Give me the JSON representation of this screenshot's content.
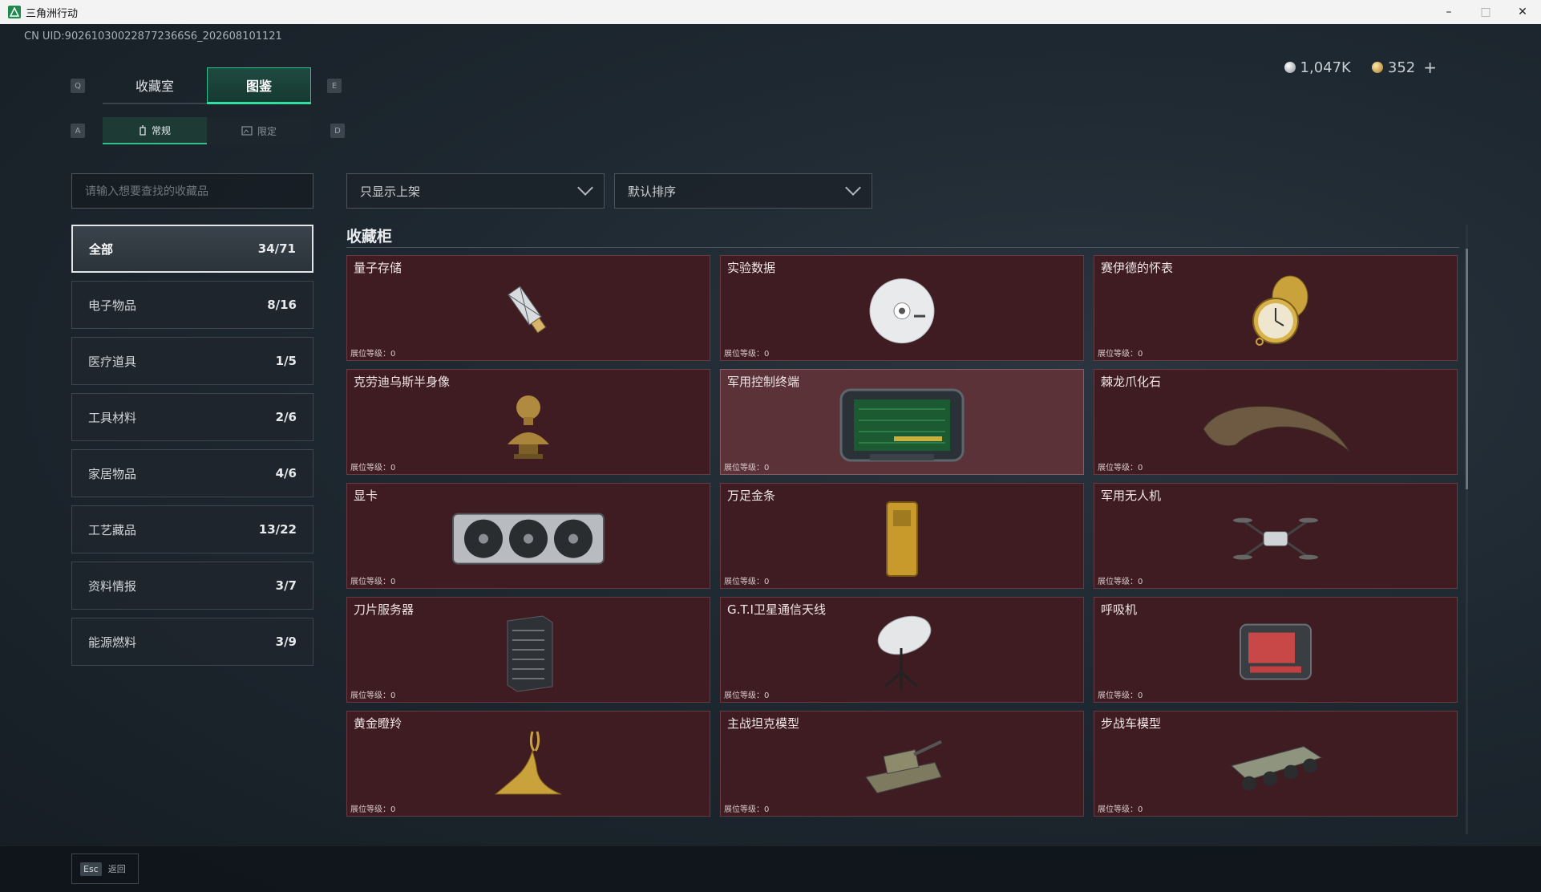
{
  "window": {
    "title": "三角洲行动",
    "min": "–",
    "max": "□",
    "close": "✕"
  },
  "uid": "CN UID:902610300228772366S6_202608101121",
  "currency": {
    "silver": "1,047K",
    "gold": "352",
    "plus": "+"
  },
  "keys": {
    "q": "Q",
    "e": "E",
    "a": "A",
    "d": "D"
  },
  "main_tabs": [
    {
      "label": "收藏室",
      "active": false
    },
    {
      "label": "图鉴",
      "active": true
    }
  ],
  "sub_tabs": [
    {
      "label": "常规",
      "active": true
    },
    {
      "label": "限定",
      "active": false
    }
  ],
  "search": {
    "placeholder": "请输入想要查找的收藏品"
  },
  "categories": [
    {
      "label": "全部",
      "count": "34/71",
      "active": true
    },
    {
      "label": "电子物品",
      "count": "8/16"
    },
    {
      "label": "医疗道具",
      "count": "1/5"
    },
    {
      "label": "工具材料",
      "count": "2/6"
    },
    {
      "label": "家居物品",
      "count": "4/6"
    },
    {
      "label": "工艺藏品",
      "count": "13/22"
    },
    {
      "label": "资料情报",
      "count": "3/7"
    },
    {
      "label": "能源燃料",
      "count": "3/9"
    }
  ],
  "filters": {
    "shelf": "只显示上架",
    "sort": "默认排序"
  },
  "section": {
    "title": "收藏柜"
  },
  "items": [
    {
      "name": "量子存储",
      "level": "展位等级：0",
      "icon": "usb-drive-icon"
    },
    {
      "name": "实验数据",
      "level": "展位等级：0",
      "icon": "disc-icon"
    },
    {
      "name": "赛伊德的怀表",
      "level": "展位等级：0",
      "icon": "pocket-watch-icon"
    },
    {
      "name": "克劳迪乌斯半身像",
      "level": "展位等级：0",
      "icon": "bust-icon"
    },
    {
      "name": "军用控制终端",
      "level": "展位等级：0",
      "icon": "terminal-icon",
      "selected": true
    },
    {
      "name": "棘龙爪化石",
      "level": "展位等级：0",
      "icon": "claw-fossil-icon"
    },
    {
      "name": "显卡",
      "level": "展位等级：0",
      "icon": "gpu-icon"
    },
    {
      "name": "万足金条",
      "level": "展位等级：0",
      "icon": "gold-bar-icon"
    },
    {
      "name": "军用无人机",
      "level": "展位等级：0",
      "icon": "drone-icon"
    },
    {
      "name": "刀片服务器",
      "level": "展位等级：0",
      "icon": "server-icon"
    },
    {
      "name": "G.T.I卫星通信天线",
      "level": "展位等级：0",
      "icon": "satellite-dish-icon"
    },
    {
      "name": "呼吸机",
      "level": "展位等级：0",
      "icon": "ventilator-icon"
    },
    {
      "name": "黄金瞪羚",
      "level": "展位等级：0",
      "icon": "gazelle-statue-icon"
    },
    {
      "name": "主战坦克模型",
      "level": "展位等级：0",
      "icon": "tank-model-icon"
    },
    {
      "name": "步战车模型",
      "level": "展位等级：0",
      "icon": "ifv-model-icon"
    }
  ],
  "footer": {
    "esc_key": "Esc",
    "back_label": "返回"
  }
}
